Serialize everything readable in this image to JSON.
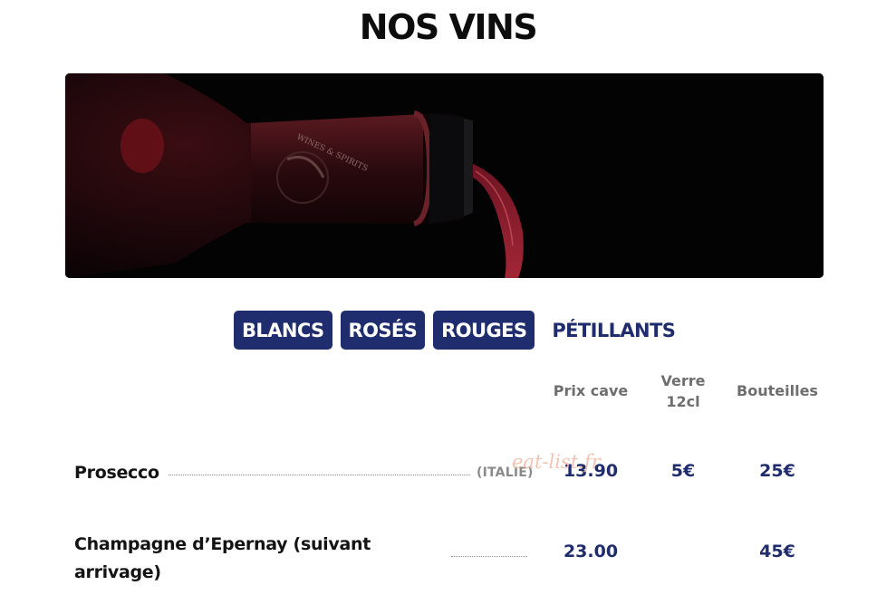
{
  "page": {
    "title": "NOS VINS"
  },
  "hero": {
    "label_text": "WINES & SPIRITS"
  },
  "tabs": [
    {
      "label": "BLANCS",
      "active": false
    },
    {
      "label": "ROSÉS",
      "active": false
    },
    {
      "label": "ROUGES",
      "active": false
    },
    {
      "label": "PÉTILLANTS",
      "active": true
    }
  ],
  "columns": {
    "cave": "Prix cave",
    "verre_line1": "Verre",
    "verre_line2": "12cl",
    "bouteilles": "Bouteilles"
  },
  "wines": [
    {
      "name": "Prosecco",
      "origin": "(ITALIE)",
      "prix_cave": "13.90",
      "verre": "5€",
      "bouteille": "25€"
    },
    {
      "name_line1": "Champagne d’Epernay (suivant",
      "name_line2": "arrivage)",
      "prix_cave": "23.00",
      "bouteille": "45€"
    }
  ],
  "watermark": "eat-list.fr",
  "colors": {
    "accent": "#1f2d6e",
    "muted": "#6e6e6e",
    "watermark": "#f2b9a4"
  }
}
